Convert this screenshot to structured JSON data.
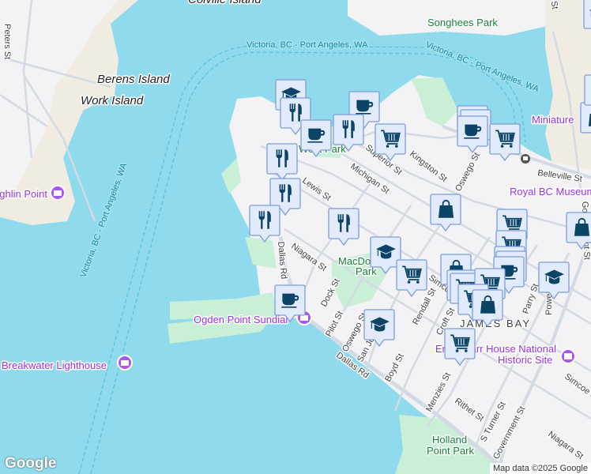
{
  "islands": {
    "colville": "Colville Island",
    "berens": "Berens Island",
    "work": "Work Island"
  },
  "parks": {
    "songhees": "Songhees Park",
    "west": "West Park",
    "macdonald_1": "MacDonald",
    "macdonald_2": "Park",
    "holland_1": "Holland",
    "holland_2": "Point Park"
  },
  "ferry_route": "Victoria, BC - Port Angeles, WA",
  "pois": {
    "miniature": "Miniature",
    "royal_bc_museum": "Royal BC Museum",
    "ogden_point": "Ogden Point Sundial",
    "breakwater": "Breakwater Lighthouse",
    "mcloughlin": "McLoughlin Point",
    "carr_1": "Emily Carr House National",
    "carr_2": "Historic Site"
  },
  "neighborhood": "JAMES BAY",
  "streets": {
    "belleville": "Belleville St",
    "superior": "Superior St",
    "kingston": "Kingston St",
    "michigan": "Michigan St",
    "oswego": "Oswego St",
    "pe": "Lewis St",
    "niagara": "Niagara St",
    "dallas": "Dallas Rd",
    "dock": "Dock St",
    "pilot": "Pilot St",
    "san_jose": "San Jose Ave",
    "boyd": "Boyd St",
    "rendall": "Rendall St",
    "simcoe": "Simcoe St",
    "croft": "Croft St",
    "menzies": "Menzies St",
    "rithet": "Rithet St",
    "s_turner": "S Turner St",
    "government": "Government St",
    "parry": "Parry St",
    "powell": "Powell St",
    "wharf": "Wharf St",
    "peters": "Peters St"
  },
  "attribution": "Map data ©2025 Google",
  "logo": "Google",
  "colors": {
    "water": "#8fdaec",
    "land": "#f3f2f4",
    "park": "#c9efd7",
    "marker_fill": "#e2ebfc",
    "marker_border": "#7c9ce0",
    "icon": "#0b4466",
    "poi": "#9334e6"
  }
}
